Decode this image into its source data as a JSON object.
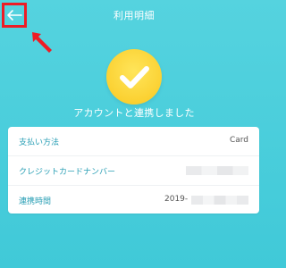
{
  "header": {
    "title": "利用明細",
    "back_icon": "arrow-left-icon"
  },
  "success": {
    "icon": "check-icon",
    "message": "アカウントと連携しました"
  },
  "details": {
    "rows": [
      {
        "label": "支払い方法",
        "value": "Card"
      },
      {
        "label": "クレジットカードナンバー",
        "value": ""
      },
      {
        "label": "連携時間",
        "value": "2019-"
      }
    ]
  },
  "colors": {
    "background": "#4dd0dc",
    "accent": "#2a9fb5",
    "highlight": "#ee1c25",
    "success": "#fbd132"
  }
}
